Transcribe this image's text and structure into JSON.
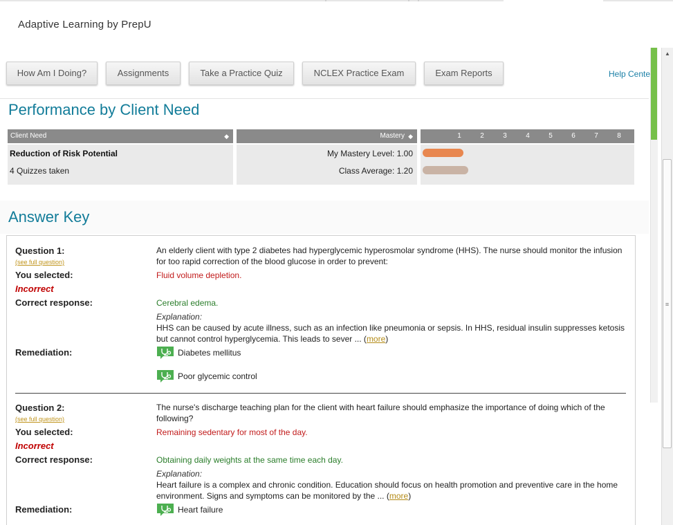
{
  "app": {
    "title": "Adaptive Learning by PrepU"
  },
  "nav": {
    "buttons": [
      {
        "label": "How Am I Doing?"
      },
      {
        "label": "Assignments"
      },
      {
        "label": "Take a Practice Quiz"
      },
      {
        "label": "NCLEX Practice Exam"
      },
      {
        "label": "Exam Reports"
      }
    ],
    "help": "Help Cente"
  },
  "performance": {
    "title": "Performance by Client Need",
    "headers": {
      "client_need": "Client Need",
      "mastery": "Mastery",
      "sort_glyph": "◆"
    },
    "scale": [
      "1",
      "2",
      "3",
      "4",
      "5",
      "6",
      "7",
      "8"
    ],
    "row": {
      "need": "Reduction of Risk Potential",
      "quizzes": "4 Quizzes taken",
      "my_mastery": "My Mastery Level: 1.00",
      "class_average": "Class Average: 1.20",
      "my_mastery_value": 1.0,
      "class_average_value": 1.2,
      "scale_max": 8,
      "my_bar_color": "#e8874f",
      "class_bar_color": "#c9b3a5"
    }
  },
  "answer_key": {
    "title": "Answer Key",
    "labels": {
      "see_full": "(see full question)",
      "you_selected": "You selected:",
      "incorrect": "Incorrect",
      "correct_response": "Correct response:",
      "explanation": "Explanation:",
      "remediation": "Remediation:",
      "more": "more"
    },
    "questions": [
      {
        "label": "Question 1:",
        "text": "An elderly client with type 2 diabetes had hyperglycemic hyperosmolar syndrome (HHS). The nurse should monitor the infusion for too rapid correction of the blood glucose in order to prevent:",
        "selected": "Fluid volume depletion.",
        "correct": "Cerebral edema.",
        "explanation": "HHS can be caused by acute illness, such as an infection like pneumonia or sepsis. In HHS, residual insulin suppresses ketosis but cannot control hyperglycemia. This leads to sever ... (",
        "remediation": [
          "Diabetes mellitus",
          "Poor glycemic control"
        ]
      },
      {
        "label": "Question 2:",
        "text": "The nurse's discharge teaching plan for the client with heart failure should emphasize the importance of doing which of the following?",
        "selected": "Remaining sedentary for most of the day.",
        "correct": "Obtaining daily weights at the same time each day.",
        "explanation": "Heart failure is a complex and chronic condition. Education should focus on health promotion and preventive care in the home environment. Signs and symptoms can be monitored by the ... (",
        "remediation": [
          "Heart failure"
        ]
      }
    ]
  },
  "colors": {
    "accent": "#127c99",
    "incorrect": "#c00000",
    "correct": "#2a7d2a",
    "scroll_green": "#76c04a",
    "remediation_icon": "#4caf50"
  },
  "icons": {
    "remediation": "stethoscope-icon",
    "scroll_up": "arrow-up-icon",
    "scroll_down": "arrow-down-icon"
  }
}
